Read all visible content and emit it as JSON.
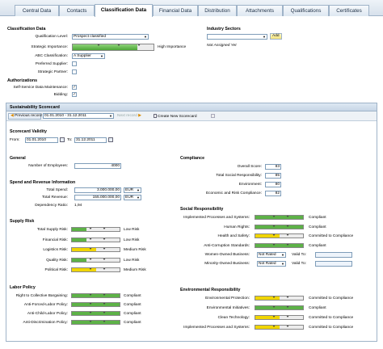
{
  "tabs": [
    "Central Data",
    "Contacts",
    "Classification Data",
    "Financial Data",
    "Distribution",
    "Attachments",
    "Qualifications",
    "Certificates"
  ],
  "classification": {
    "title": "Classification Data",
    "qualification_label": "Qualification Level:",
    "qualification_value": "Prospect classified",
    "strategic_label": "Strategic Importance:",
    "strategic_text": "High Importance",
    "strategic_level": 0.8,
    "abc_label": "ABC Classification:",
    "abc_value": "A Supplier",
    "preferred_label": "Preferred Supplier:",
    "partner_label": "Strategic Partner:"
  },
  "industry": {
    "title": "Industry Sectors",
    "add_label": "Add",
    "not_assigned": "Not Assigned Yet"
  },
  "authorizations": {
    "title": "Authorizations",
    "self_service_label": "Self-Service Data Maintenance:",
    "bidding_label": "Bidding:",
    "check_mark": "✓"
  },
  "scorecard": {
    "title": "Sustainability Scorecard",
    "previous_label": "Previous record",
    "record_range": "01.01.2010 - 31.12.2011",
    "next_label": "Next record",
    "create_label": "Create New Scorecard"
  },
  "validity": {
    "title": "Scorecard Validity",
    "from_label": "From:",
    "from_value": "01.01.2010",
    "to_label": "To:",
    "to_value": "31.12.2011"
  },
  "general": {
    "title": "General",
    "employees_label": "Number of Employees:",
    "employees_value": "4000"
  },
  "spend": {
    "title": "Spend and Revenue Information",
    "total_spend_label": "Total Spend:",
    "total_spend_value": "3.000.000,00",
    "total_spend_currency": "EUR",
    "total_revenue_label": "Total Revenue:",
    "total_revenue_value": "155.000.000,00",
    "total_revenue_currency": "EUR",
    "dependency_label": "Dependency Ratio:",
    "dependency_value": "1,94"
  },
  "compliance": {
    "title": "Compliance",
    "items": [
      {
        "label": "Overall Score:",
        "value": "83"
      },
      {
        "label": "Total Social Responsibility:",
        "value": "85"
      },
      {
        "label": "Environment:",
        "value": "80"
      },
      {
        "label": "Economic and Risk Compliance:",
        "value": "82"
      }
    ]
  },
  "supply_risk": {
    "title": "Supply Risk",
    "items": [
      {
        "label": "Total Supply Risk:",
        "status": "Low Risk",
        "color": "#5db247",
        "level": 0.3
      },
      {
        "label": "Financial Risk:",
        "status": "Low Risk",
        "color": "#5db247",
        "level": 0.3
      },
      {
        "label": "Logistics Risk:",
        "status": "Medium Risk",
        "color": "#f0d500",
        "level": 0.5
      },
      {
        "label": "Quality Risk:",
        "status": "Low Risk",
        "color": "#5db247",
        "level": 0.3
      },
      {
        "label": "Political Risk:",
        "status": "Medium Risk",
        "color": "#f0d500",
        "level": 0.5
      }
    ]
  },
  "social": {
    "title": "Social Responsibility",
    "items": [
      {
        "label": "Implemented Processes and Systems:",
        "status": "Compliant",
        "color": "#5db247",
        "level": 1.0
      },
      {
        "label": "Human Rights:",
        "status": "Compliant",
        "color": "#5db247",
        "level": 1.0
      },
      {
        "label": "Health and Safety:",
        "status": "Committed to Compliance",
        "color": "#f0d500",
        "level": 0.5
      },
      {
        "label": "Anti-Corruption Standards:",
        "status": "Compliant",
        "color": "#5db247",
        "level": 1.0
      }
    ],
    "women_label": "Women-Owned Business:",
    "minority_label": "Minority-Owned Business:",
    "not_rated": "Not Rated",
    "valid_to_label": "Valid To:"
  },
  "labor": {
    "title": "Labor Policy",
    "items": [
      {
        "label": "Right to Collective Bargaining:",
        "status": "Compliant",
        "color": "#5db247",
        "level": 1.0
      },
      {
        "label": "Anti-Forced-Labor Policy:",
        "status": "Compliant",
        "color": "#5db247",
        "level": 1.0
      },
      {
        "label": "Anti-Child-Labor Policy:",
        "status": "Compliant",
        "color": "#5db247",
        "level": 1.0
      },
      {
        "label": "Anti-Discrimination Policy:",
        "status": "Compliant",
        "color": "#5db247",
        "level": 1.0
      }
    ]
  },
  "environmental": {
    "title": "Environmental Responsibility",
    "items": [
      {
        "label": "Environmental Protection:",
        "status": "Committed to Compliance",
        "color": "#f0d500",
        "level": 0.5
      },
      {
        "label": "Environmental Initiatives:",
        "status": "Compliant",
        "color": "#5db247",
        "level": 1.0
      },
      {
        "label": "Clean Technology:",
        "status": "Committed to Compliance",
        "color": "#f0d500",
        "level": 0.5
      },
      {
        "label": "Implemented Processes and Systems:",
        "status": "Committed to Compliance",
        "color": "#f0d500",
        "level": 0.5
      }
    ]
  }
}
